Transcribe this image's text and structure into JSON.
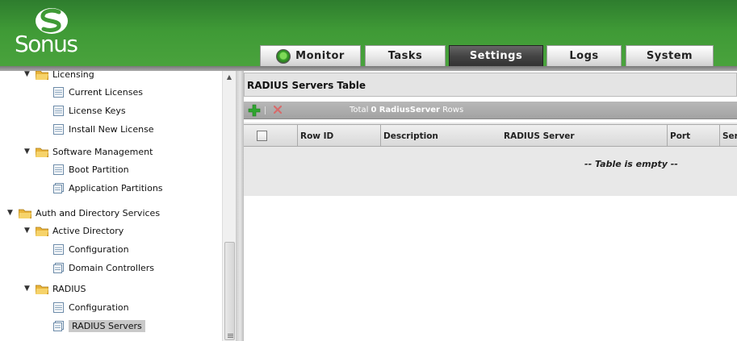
{
  "header": {
    "logo_text": "Sonus",
    "tabs": [
      {
        "label": "Monitor"
      },
      {
        "label": "Tasks"
      },
      {
        "label": "Settings"
      },
      {
        "label": "Logs"
      },
      {
        "label": "System"
      }
    ],
    "active_tab": "Settings"
  },
  "sidebar": {
    "licensing": "Licensing",
    "current_licenses": "Current Licenses",
    "license_keys": "License Keys",
    "install_new_license": "Install New License",
    "software_management": "Software Management",
    "boot_partition": "Boot Partition",
    "application_partitions": "Application Partitions",
    "auth_directory_services": "Auth and Directory Services",
    "active_directory": "Active Directory",
    "ad_configuration": "Configuration",
    "domain_controllers": "Domain Controllers",
    "radius": "RADIUS",
    "radius_configuration": "Configuration",
    "radius_servers": "RADIUS Servers",
    "selected": "RADIUS Servers"
  },
  "main": {
    "title": "RADIUS Servers Table",
    "toolbar": {
      "total_prefix": "Total",
      "count": "0",
      "entity": "RadiusServer",
      "suffix": "Rows"
    },
    "columns": [
      "Row ID",
      "Description",
      "RADIUS Server",
      "Port",
      "Ser"
    ],
    "empty_message": "-- Table is empty --"
  },
  "colors": {
    "header_green": "#3f9a36",
    "active_tab": "#444444",
    "add_icon": "#2fa52f",
    "delete_icon": "#d86a6a"
  },
  "icons": [
    "sonus-logo-icon",
    "monitor-status-icon",
    "expand-arrow-icon",
    "folder-icon",
    "page-icon",
    "add-icon",
    "delete-icon",
    "scroll-up-icon"
  ]
}
